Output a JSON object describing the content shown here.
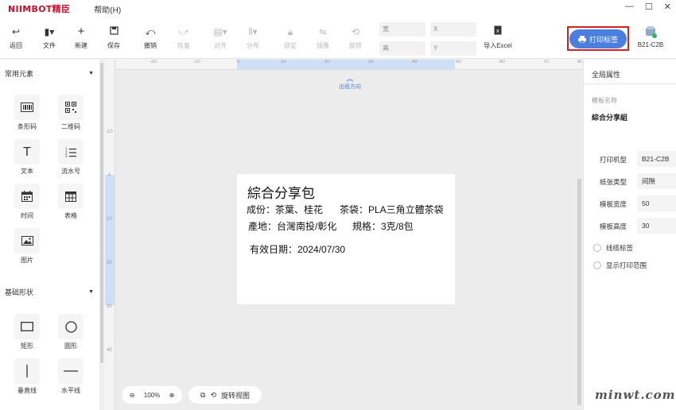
{
  "title_bar": {
    "brand": "NIIMBOT精臣",
    "help_menu": "帮助(H)",
    "min_glyph": "—",
    "max_glyph": "☐",
    "close_glyph": "✕"
  },
  "toolbar": {
    "back": "返回",
    "file": "文件",
    "new": "新建",
    "save": "保存",
    "undo": "撤销",
    "redo": "恢复",
    "align": "对齐",
    "distribute": "分布",
    "lock": "锁定",
    "mirror": "镜像",
    "rotate": "旋转",
    "width_label": "宽",
    "height_label": "高",
    "x_label": "X",
    "y_label": "Y",
    "import_excel": "导入Excel",
    "print_label": "打印标签",
    "device_model": "B21-C2B"
  },
  "left_panel": {
    "common_header": "常用元素",
    "common_items": [
      {
        "label": "条形码",
        "icon": "barcode-icon"
      },
      {
        "label": "二维码",
        "icon": "qrcode-icon"
      },
      {
        "label": "文本",
        "icon": "text-icon"
      },
      {
        "label": "流水号",
        "icon": "serial-number-icon"
      },
      {
        "label": "时间",
        "icon": "calendar-icon"
      },
      {
        "label": "表格",
        "icon": "table-icon"
      },
      {
        "label": "图片",
        "icon": "image-icon"
      }
    ],
    "shape_header": "基础形状",
    "shape_items": [
      {
        "label": "矩形",
        "icon": "rectangle-icon"
      },
      {
        "label": "圆形",
        "icon": "circle-icon"
      },
      {
        "label": "垂直线",
        "icon": "vertical-line-icon"
      },
      {
        "label": "水平线",
        "icon": "horizontal-line-icon"
      }
    ]
  },
  "canvas": {
    "ruler_top": [
      "-20",
      "-10",
      "0",
      "10",
      "20",
      "30",
      "40",
      "50",
      "60",
      "70",
      "80"
    ],
    "ruler_left": [
      "-10",
      "0",
      "10",
      "20",
      "30",
      "40"
    ],
    "paper_direction": "出纸方向",
    "label_lines": [
      "綜合分享包",
      "成份：茶葉、桂花",
      "茶袋：PLA三角立體茶袋",
      "產地：台灣南投/彰化",
      "規格：3克/8包",
      "有效日期：2024/07/30"
    ],
    "zoom_level": "100%",
    "rotate_view": "旋转视图"
  },
  "right_panel": {
    "title": "全局属性",
    "template_name_label": "模板名称",
    "template_name": "綜合分享組",
    "printer_label": "打印机型",
    "printer_value": "B21-C2B",
    "paper_type_label": "纸张类型",
    "paper_type_value": "间隙",
    "width_label": "模板宽度",
    "width_value": "50",
    "height_label": "模板高度",
    "height_value": "30",
    "cable_label": "线缆标签",
    "show_print_range": "显示打印范围"
  },
  "watermark": "minwt.com",
  "colors": {
    "accent": "#4a7fe0",
    "highlight_border": "#d62020",
    "brand": "#c8102e"
  }
}
